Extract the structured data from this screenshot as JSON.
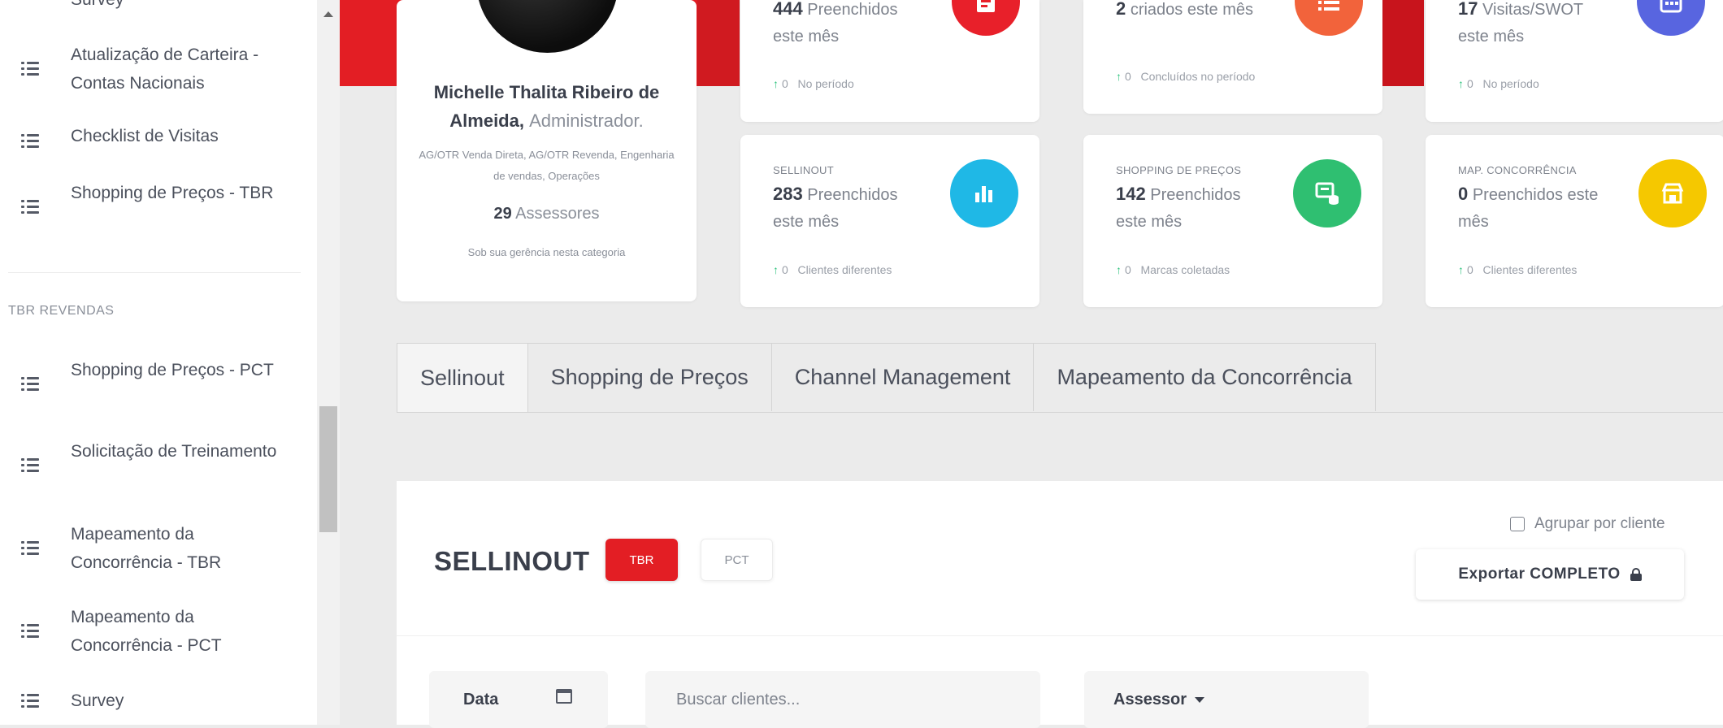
{
  "sidebar": {
    "items_top": [
      {
        "label": "Survey"
      },
      {
        "label": "Atualização de Carteira - Contas Nacionais"
      },
      {
        "label": "Checklist de Visitas"
      },
      {
        "label": "Shopping de Preços - TBR"
      }
    ],
    "section_title": "TBR REVENDAS",
    "items_bottom": [
      {
        "label": "Shopping de Preços - PCT"
      },
      {
        "label": "Solicitação de Treinamento"
      },
      {
        "label": "Mapeamento da Concorrência - TBR"
      },
      {
        "label": "Mapeamento da Concorrência - PCT"
      },
      {
        "label": "Survey"
      }
    ]
  },
  "profile": {
    "name": "Michelle Thalita Ribeiro de Almeida",
    "role": "Administrador.",
    "departments": "AG/OTR Venda Direta, AG/OTR Revenda, Engenharia de vendas, Operações",
    "count_value": "29",
    "count_label": "Assessores",
    "subtitle": "Sob sua gerência nesta categoria"
  },
  "stats_top": [
    {
      "value": "444",
      "text": "Preenchidos este mês",
      "foot_value": "0",
      "foot_text": "No período",
      "icon": "document-icon",
      "color": "#e8202a"
    },
    {
      "value": "2",
      "text": "criados este mês",
      "foot_value": "0",
      "foot_text": "Concluídos no período",
      "icon": "list-icon",
      "color": "#f2633b"
    },
    {
      "value": "17",
      "text": "Visitas/SWOT este mês",
      "foot_value": "0",
      "foot_text": "No período",
      "icon": "calendar-icon",
      "color": "#5865e0"
    }
  ],
  "stats_bottom": [
    {
      "label": "SELLINOUT",
      "value": "283",
      "text": "Preenchidos este mês",
      "foot_value": "0",
      "foot_text": "Clientes diferentes",
      "icon": "bar-chart-icon",
      "color": "#1fb8e6"
    },
    {
      "label": "SHOPPING DE PREÇOS",
      "value": "142",
      "text": "Preenchidos este mês",
      "foot_value": "0",
      "foot_text": "Marcas coletadas",
      "icon": "price-icon",
      "color": "#2fbf71"
    },
    {
      "label": "MAP. CONCORRÊNCIA",
      "value": "0",
      "text": "Preenchidos este mês",
      "foot_value": "0",
      "foot_text": "Clientes diferentes",
      "icon": "store-icon",
      "color": "#f5c800"
    }
  ],
  "tabs": [
    "Sellinout",
    "Shopping de Preços",
    "Channel Management",
    "Mapeamento da Concorrência"
  ],
  "panel": {
    "title": "SELLINOUT",
    "pill_tbr": "TBR",
    "pill_pct": "PCT",
    "group_label": "Agrupar por cliente",
    "export_label": "Exportar COMPLETO",
    "date_label": "Data",
    "search_placeholder": "Buscar clientes...",
    "assessor_label": "Assessor"
  },
  "colors": {
    "brand_red": "#e31e24"
  }
}
